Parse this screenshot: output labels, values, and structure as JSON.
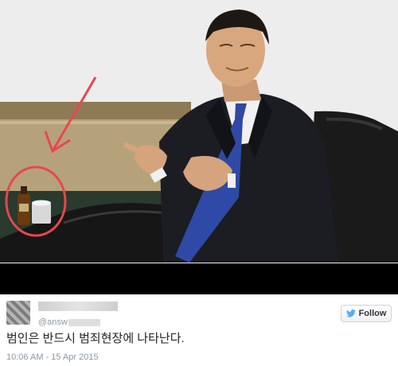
{
  "tweet": {
    "handle_prefix": "@answ",
    "follow_label": "Follow",
    "text": "범인은 반드시 범죄현장에 나타난다.",
    "timestamp": "10:06 AM - 15 Apr 2015"
  },
  "colors": {
    "annotation": "#e8474e",
    "link_blue": "#55acee",
    "meta_gray": "#8899a6"
  },
  "icons": {
    "follow": "twitter-bird-icon",
    "annotation_arrow": "red-arrow-icon",
    "annotation_circle": "red-circle-icon"
  }
}
